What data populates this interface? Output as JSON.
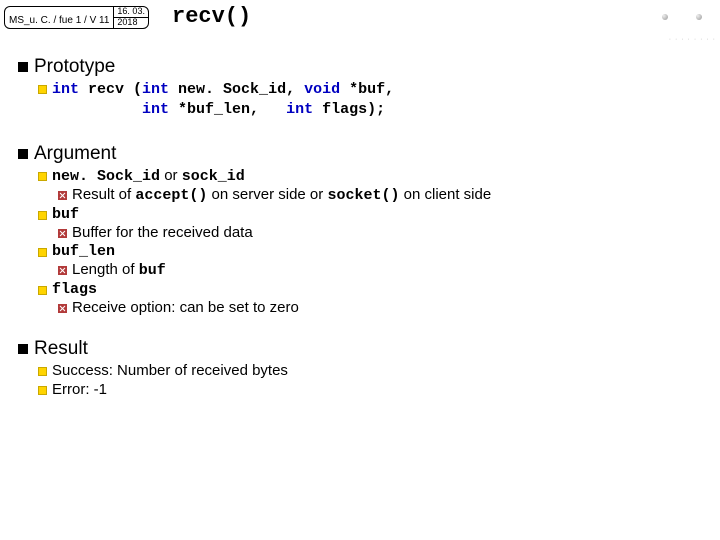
{
  "header": {
    "label": "MS_u. C. / fue 1 / V 11",
    "date_top": "16. 03.",
    "date_bottom": "2018"
  },
  "title": "recv()",
  "sections": {
    "prototype": {
      "heading": "Prototype",
      "sig_line1_pre": "int",
      "sig_line1_name": " recv (",
      "sig_line1_p1_kw": "int",
      "sig_line1_p1": " new. Sock_id, ",
      "sig_line1_p2_kw": "void",
      "sig_line1_p2": " *buf,",
      "sig_line2_pad": "          ",
      "sig_line2_p3_kw": "int",
      "sig_line2_p3": " *buf_len,   ",
      "sig_line2_p4_kw": "int",
      "sig_line2_p4": " flags);"
    },
    "argument": {
      "heading": "Argument",
      "a1_code1": "new. Sock_id",
      "a1_mid": " or ",
      "a1_code2": "sock_id",
      "a1_desc_pre": "Result of ",
      "a1_desc_c1": "accept()",
      "a1_desc_mid": " on server side or ",
      "a1_desc_c2": "socket()",
      "a1_desc_post": " on client side",
      "a2_code": "buf",
      "a2_desc": "Buffer for the received data",
      "a3_code": "buf_len",
      "a3_desc_pre": "Length of ",
      "a3_desc_code": "buf",
      "a4_code": "flags",
      "a4_desc": "Receive option: can be set to zero"
    },
    "result": {
      "heading": "Result",
      "r1": "Success: Number of received bytes",
      "r2": "Error: -1"
    }
  }
}
